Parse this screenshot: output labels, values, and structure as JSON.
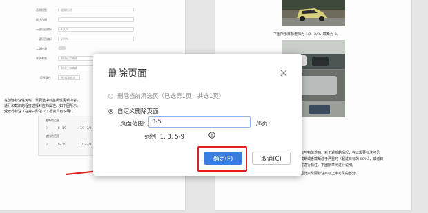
{
  "dialog": {
    "title": "删除页面",
    "option_current": "删除当前所选页（已选第1页，共选1页）",
    "option_custom": "自定义删除页面",
    "range_label": "页面范围:",
    "range_value": "3-5",
    "total_pages": "/6页",
    "example": "范例: 1, 3, 5-9",
    "confirm_label": "确定(F)",
    "cancel_label": "取消(C)"
  },
  "background_left": {
    "form_rows": [
      {
        "label": "否则模型",
        "value": "道路检测"
      },
      {
        "label": "截止日期",
        "value": ""
      },
      {
        "label": "一级项目编码",
        "value": "100%"
      },
      {
        "label": "一级项目编码",
        "value": "100%"
      },
      {
        "label": "二级检测",
        "value": ""
      },
      {
        "label": "详情视频",
        "value": "测试任务编辑"
      },
      {
        "label": "",
        "value": "测试任务编辑"
      },
      {
        "label": "可视属性",
        "value": "无   道路检测"
      }
    ],
    "paragraph": [
      "在创建标注任务时，需要选中标签属性更新内容，",
      "通行和截断的程度选择对应的属性。如下图所示。",
      "受遮行标注（在第三阶段 2D 框会具有说明）。"
    ],
    "panel_rows": [
      {
        "title": "截断的范围",
        "opts": [
          "0",
          "0~1/3",
          "1/3~2/3"
        ]
      },
      {
        "title": "遮挡的范围",
        "opts": [
          "0",
          "0~1/3",
          "1/3~2/3"
        ]
      }
    ]
  },
  "background_right": {
    "caption": "下图所示目标遮挡为 1/3~2/3，截断为 0。",
    "paragraph": [
      "目标与物体遮挡。对于遮挡的情况，在以需要标注可见",
      "，截断或者截断过于严重时（超过目标的 90%），或者目",
      "，可进行标注。下图所举例进行说明。",
      "，因此只需要标注目标上半可见的部分。"
    ]
  },
  "colors": {
    "accent": "#3a7de0",
    "highlight": "#e02020"
  }
}
